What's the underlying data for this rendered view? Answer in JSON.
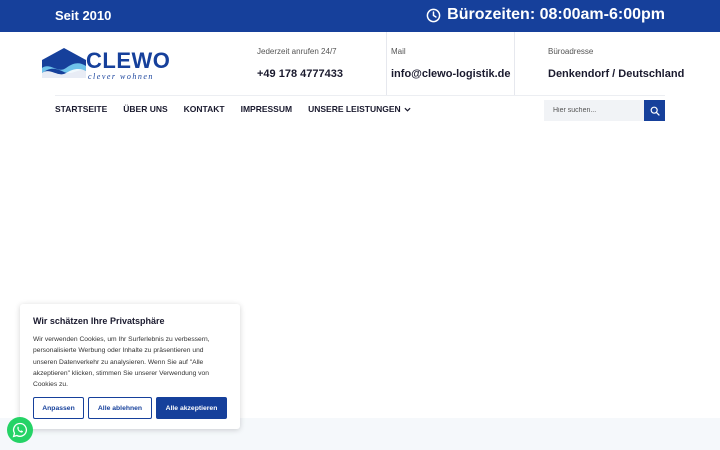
{
  "topbar": {
    "since": "Seit 2010",
    "hours": "Bürozeiten: 08:00am-6:00pm"
  },
  "logo": {
    "name": "CLEWO",
    "tagline": "clever wohnen"
  },
  "contact": [
    {
      "label": "Jederzeit anrufen 24/7",
      "value": "+49 178 4777433"
    },
    {
      "label": "Mail",
      "value": "info@clewo-logistik.de"
    },
    {
      "label": "Büroadresse",
      "value": "Denkendorf / Deutschland"
    }
  ],
  "nav": {
    "items": [
      "STARTSEITE",
      "ÜBER UNS",
      "KONTAKT",
      "IMPRESSUM",
      "UNSERE LEISTUNGEN"
    ]
  },
  "search": {
    "placeholder": "Hier suchen..."
  },
  "cookie": {
    "title": "Wir schätzen Ihre Privatsphäre",
    "text": "Wir verwenden Cookies, um Ihr Surferlebnis zu verbessern, personalisierte Werbung oder Inhalte zu präsentieren und unseren Datenverkehr zu analysieren. Wenn Sie auf \"Alle akzeptieren\" klicken, stimmen Sie unserer Verwendung von Cookies zu.",
    "customize": "Anpassen",
    "reject": "Alle ablehnen",
    "accept": "Alle akzeptieren"
  },
  "colors": {
    "brand": "#16409b",
    "whatsapp": "#25d366"
  },
  "icons": [
    "clock-icon",
    "search-icon",
    "chevron-down-icon",
    "whatsapp-icon"
  ]
}
